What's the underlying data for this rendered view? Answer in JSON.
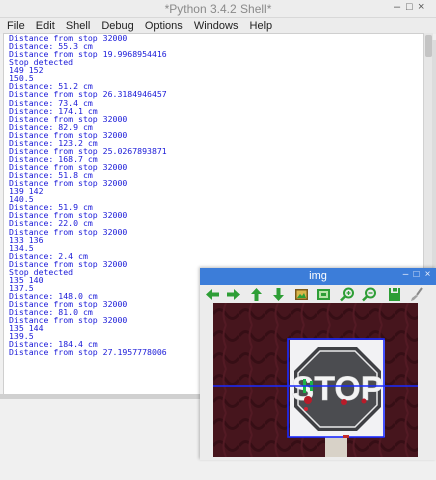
{
  "shell": {
    "title": "*Python 3.4.2 Shell*",
    "window_buttons": [
      "–",
      "□",
      "×"
    ],
    "menu": [
      "File",
      "Edit",
      "Shell",
      "Debug",
      "Options",
      "Windows",
      "Help"
    ],
    "output_lines": [
      "Distance from stop 32000",
      "Distance: 55.3 cm",
      "Distance from stop 19.9968954416",
      "Stop detected",
      "149 152",
      "150.5",
      "Distance: 51.2 cm",
      "Distance from stop 26.3184946457",
      "Distance: 73.4 cm",
      "Distance: 174.1 cm",
      "Distance from stop 32000",
      "Distance: 82.9 cm",
      "Distance from stop 32000",
      "Distance: 123.2 cm",
      "Distance from stop 25.0267893871",
      "Distance: 168.7 cm",
      "Distance from stop 32000",
      "Distance: 51.8 cm",
      "Distance from stop 32000",
      "139 142",
      "140.5",
      "Distance: 51.9 cm",
      "Distance from stop 32000",
      "Distance: 22.0 cm",
      "Distance from stop 32000",
      "133 136",
      "134.5",
      "Distance: 2.4 cm",
      "Distance from stop 32000",
      "Stop detected",
      "135 140",
      "137.5",
      "Distance: 148.0 cm",
      "Distance from stop 32000",
      "Distance: 81.0 cm",
      "Distance from stop 32000",
      "135 144",
      "139.5",
      "Distance: 184.4 cm",
      "Distance from stop 27.1957778006"
    ]
  },
  "img_window": {
    "title": "img",
    "window_buttons": [
      "–",
      "□",
      "×"
    ],
    "toolbar_icons": [
      "arrow-left-icon",
      "arrow-right-icon",
      "arrow-up-icon",
      "arrow-down-icon",
      "image-icon",
      "image-frame-icon",
      "zoom-in-icon",
      "zoom-out-icon",
      "save-icon",
      "settings-brush-icon"
    ],
    "sign_text": "STOP",
    "colors": {
      "title_bar": "#3c7dd9",
      "toolbar_icon_green": "#2e9e36",
      "detection_box": "#1a2bff",
      "sign_red": "#b81c2a"
    }
  }
}
